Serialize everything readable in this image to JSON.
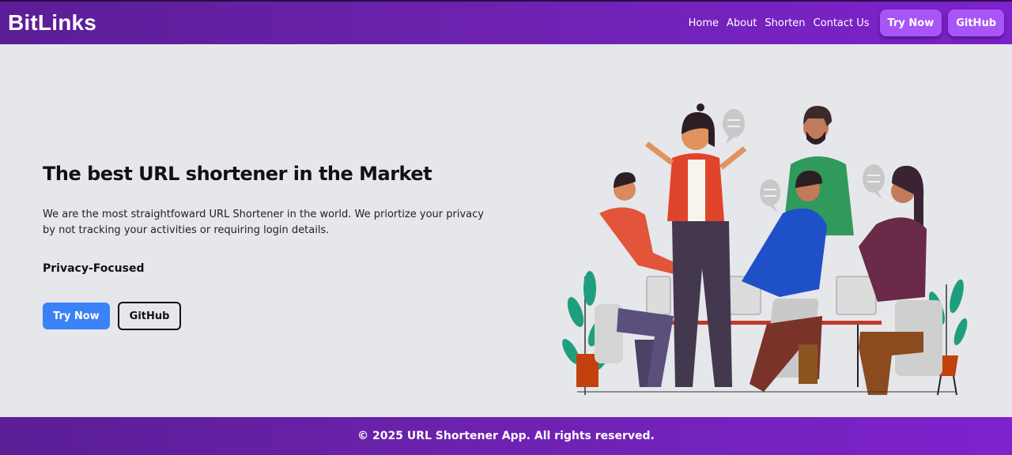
{
  "navbar": {
    "logo": "BitLinks",
    "links": [
      "Home",
      "About",
      "Shorten",
      "Contact Us"
    ],
    "try_now": "Try Now",
    "github": "GitHub"
  },
  "hero": {
    "title": "The best URL shortener in the Market",
    "description": "We are the most straightfoward URL Shortener in the world. We priortize your privacy by not tracking your activities or requiring login details.",
    "feature": "Privacy-Focused",
    "try_now": "Try Now",
    "github": "GitHub"
  },
  "footer": {
    "text": "© 2025 URL Shortener App. All rights reserved."
  },
  "colors": {
    "nav_gradient_start": "#5b1e96",
    "nav_gradient_end": "#7e22ce",
    "nav_button": "#a855f7",
    "primary_button": "#3b82f6",
    "background": "#e5e7eb"
  }
}
